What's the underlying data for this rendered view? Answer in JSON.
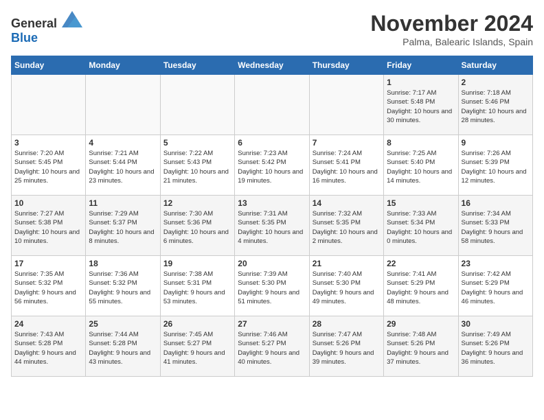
{
  "header": {
    "logo_general": "General",
    "logo_blue": "Blue",
    "month_title": "November 2024",
    "location": "Palma, Balearic Islands, Spain"
  },
  "days_of_week": [
    "Sunday",
    "Monday",
    "Tuesday",
    "Wednesday",
    "Thursday",
    "Friday",
    "Saturday"
  ],
  "weeks": [
    [
      {
        "day": "",
        "info": "",
        "empty": true
      },
      {
        "day": "",
        "info": "",
        "empty": true
      },
      {
        "day": "",
        "info": "",
        "empty": true
      },
      {
        "day": "",
        "info": "",
        "empty": true
      },
      {
        "day": "",
        "info": "",
        "empty": true
      },
      {
        "day": "1",
        "info": "Sunrise: 7:17 AM\nSunset: 5:48 PM\nDaylight: 10 hours and 30 minutes."
      },
      {
        "day": "2",
        "info": "Sunrise: 7:18 AM\nSunset: 5:46 PM\nDaylight: 10 hours and 28 minutes."
      }
    ],
    [
      {
        "day": "3",
        "info": "Sunrise: 7:20 AM\nSunset: 5:45 PM\nDaylight: 10 hours and 25 minutes."
      },
      {
        "day": "4",
        "info": "Sunrise: 7:21 AM\nSunset: 5:44 PM\nDaylight: 10 hours and 23 minutes."
      },
      {
        "day": "5",
        "info": "Sunrise: 7:22 AM\nSunset: 5:43 PM\nDaylight: 10 hours and 21 minutes."
      },
      {
        "day": "6",
        "info": "Sunrise: 7:23 AM\nSunset: 5:42 PM\nDaylight: 10 hours and 19 minutes."
      },
      {
        "day": "7",
        "info": "Sunrise: 7:24 AM\nSunset: 5:41 PM\nDaylight: 10 hours and 16 minutes."
      },
      {
        "day": "8",
        "info": "Sunrise: 7:25 AM\nSunset: 5:40 PM\nDaylight: 10 hours and 14 minutes."
      },
      {
        "day": "9",
        "info": "Sunrise: 7:26 AM\nSunset: 5:39 PM\nDaylight: 10 hours and 12 minutes."
      }
    ],
    [
      {
        "day": "10",
        "info": "Sunrise: 7:27 AM\nSunset: 5:38 PM\nDaylight: 10 hours and 10 minutes."
      },
      {
        "day": "11",
        "info": "Sunrise: 7:29 AM\nSunset: 5:37 PM\nDaylight: 10 hours and 8 minutes."
      },
      {
        "day": "12",
        "info": "Sunrise: 7:30 AM\nSunset: 5:36 PM\nDaylight: 10 hours and 6 minutes."
      },
      {
        "day": "13",
        "info": "Sunrise: 7:31 AM\nSunset: 5:35 PM\nDaylight: 10 hours and 4 minutes."
      },
      {
        "day": "14",
        "info": "Sunrise: 7:32 AM\nSunset: 5:35 PM\nDaylight: 10 hours and 2 minutes."
      },
      {
        "day": "15",
        "info": "Sunrise: 7:33 AM\nSunset: 5:34 PM\nDaylight: 10 hours and 0 minutes."
      },
      {
        "day": "16",
        "info": "Sunrise: 7:34 AM\nSunset: 5:33 PM\nDaylight: 9 hours and 58 minutes."
      }
    ],
    [
      {
        "day": "17",
        "info": "Sunrise: 7:35 AM\nSunset: 5:32 PM\nDaylight: 9 hours and 56 minutes."
      },
      {
        "day": "18",
        "info": "Sunrise: 7:36 AM\nSunset: 5:32 PM\nDaylight: 9 hours and 55 minutes."
      },
      {
        "day": "19",
        "info": "Sunrise: 7:38 AM\nSunset: 5:31 PM\nDaylight: 9 hours and 53 minutes."
      },
      {
        "day": "20",
        "info": "Sunrise: 7:39 AM\nSunset: 5:30 PM\nDaylight: 9 hours and 51 minutes."
      },
      {
        "day": "21",
        "info": "Sunrise: 7:40 AM\nSunset: 5:30 PM\nDaylight: 9 hours and 49 minutes."
      },
      {
        "day": "22",
        "info": "Sunrise: 7:41 AM\nSunset: 5:29 PM\nDaylight: 9 hours and 48 minutes."
      },
      {
        "day": "23",
        "info": "Sunrise: 7:42 AM\nSunset: 5:29 PM\nDaylight: 9 hours and 46 minutes."
      }
    ],
    [
      {
        "day": "24",
        "info": "Sunrise: 7:43 AM\nSunset: 5:28 PM\nDaylight: 9 hours and 44 minutes."
      },
      {
        "day": "25",
        "info": "Sunrise: 7:44 AM\nSunset: 5:28 PM\nDaylight: 9 hours and 43 minutes."
      },
      {
        "day": "26",
        "info": "Sunrise: 7:45 AM\nSunset: 5:27 PM\nDaylight: 9 hours and 41 minutes."
      },
      {
        "day": "27",
        "info": "Sunrise: 7:46 AM\nSunset: 5:27 PM\nDaylight: 9 hours and 40 minutes."
      },
      {
        "day": "28",
        "info": "Sunrise: 7:47 AM\nSunset: 5:26 PM\nDaylight: 9 hours and 39 minutes."
      },
      {
        "day": "29",
        "info": "Sunrise: 7:48 AM\nSunset: 5:26 PM\nDaylight: 9 hours and 37 minutes."
      },
      {
        "day": "30",
        "info": "Sunrise: 7:49 AM\nSunset: 5:26 PM\nDaylight: 9 hours and 36 minutes."
      }
    ]
  ]
}
